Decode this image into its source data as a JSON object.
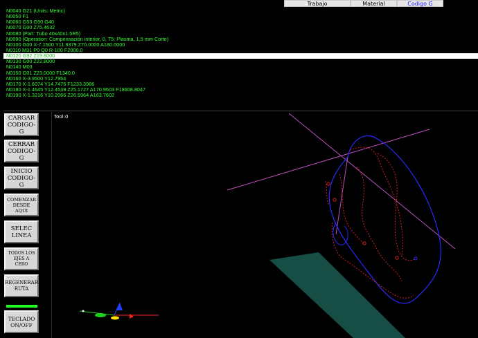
{
  "tabs": [
    {
      "label": "Trabajo"
    },
    {
      "label": "Material"
    },
    {
      "label": "Codigo G"
    }
  ],
  "gcode_lines": [
    "N0040 G21 (Units: Metric)",
    "N0050 F1",
    "N0060 G53 G90 G40",
    "N0070 G00 Z75.4632",
    "N0080 (Part: Tubo 40x40x1.5R5)",
    "N0090 (Operation: Compensación interior, 0, T5: Plasma, 1,5 mm Corte)",
    "N0100 G00 X-7.1500 Y11.9379 Z70.0000 A180.0000",
    "N0110 M31 P0 Q0 R-100 F2000.0",
    "N0120 G92 Z19.8000",
    "N0130 G00 Z22.8000",
    "N0140 M03",
    "N0150 G01 Z23.0000 F1340.0",
    "N0160 X-3.9500 Y12.7954",
    "N0170 X-1.6074 Y14.7475 F1233.3986",
    "N0180 X-1.4645 Y12.4539 Z25.1727 A170.9503 F18608.8047",
    "N0190 X-1.3216 Y10.2066 Z26.5964 A163.7602"
  ],
  "selected_line_index": 8,
  "buttons": {
    "load": "CARGAR\nCODIGO-G",
    "close": "CERRAR\nCODIGO-G",
    "start": "INICIO\nCODIGO-G",
    "start_here": "COMENZAR\nDESDE\nAQUI",
    "select_line": "SELEC\nLINEA",
    "zero_axes": "TODOS LOS\nEJES A\nCERO",
    "regen": "REGENERAR\nRUTA",
    "keyboard": "TECLADO\nON/OFF"
  },
  "viewport": {
    "tool_label": "Tool:0"
  },
  "colors": {
    "gcode_text": "#34ff34",
    "selected_row_bg": "#ffffff",
    "path_blue": "#2a2aff",
    "path_red_dotted": "#d02020",
    "guide_magenta": "#c050c0",
    "plate_teal": "#1a5a50",
    "keyboard_bar": "#22ff22",
    "active_tab_text": "#1a1aff"
  },
  "icons": {
    "axis_gizmo": "xyz-axis-gizmo-icon"
  }
}
